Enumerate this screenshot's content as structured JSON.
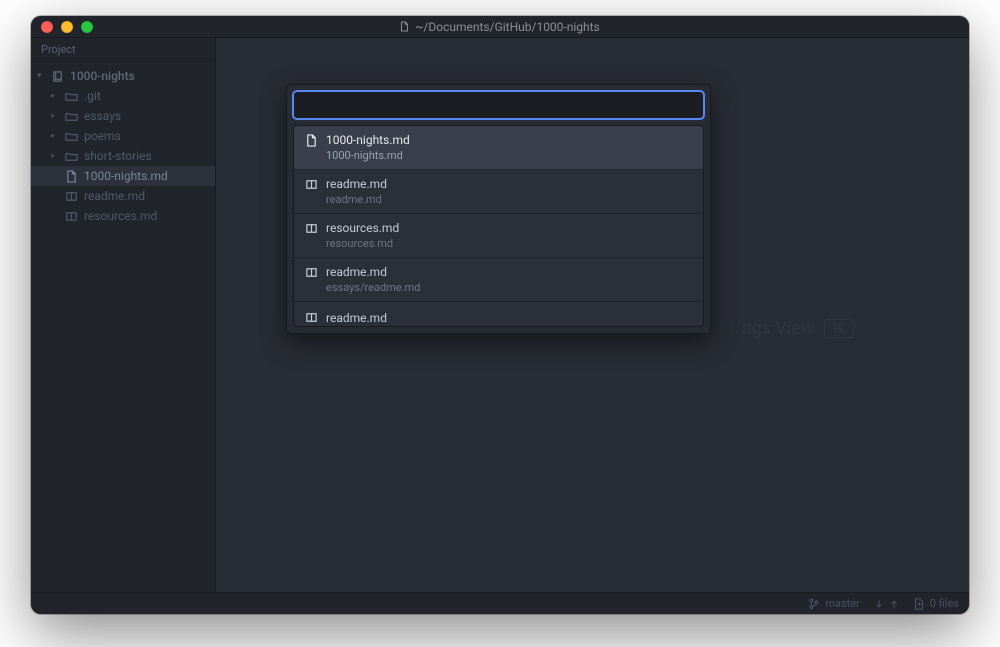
{
  "window": {
    "title_path": "~/Documents/GitHub/1000-nights"
  },
  "sidebar": {
    "header": "Project",
    "root": {
      "label": "1000-nights"
    },
    "items": [
      {
        "label": ".git",
        "kind": "folder",
        "indent": 1
      },
      {
        "label": "essays",
        "kind": "folder",
        "indent": 1
      },
      {
        "label": "poems",
        "kind": "folder",
        "indent": 1
      },
      {
        "label": "short-stories",
        "kind": "folder",
        "indent": 1
      },
      {
        "label": "1000-nights.md",
        "kind": "file-doc",
        "indent": 1,
        "selected": true
      },
      {
        "label": "readme.md",
        "kind": "file-book",
        "indent": 1
      },
      {
        "label": "resources.md",
        "kind": "file-book",
        "indent": 1
      }
    ]
  },
  "ghost": {
    "text": "ngs View",
    "shortcut": "⌘,"
  },
  "fuzzy": {
    "search_value": "",
    "placeholder": "",
    "results": [
      {
        "name": "1000-nights.md",
        "path": "1000-nights.md",
        "icon": "file-doc",
        "selected": true
      },
      {
        "name": "readme.md",
        "path": "readme.md",
        "icon": "file-book",
        "selected": false
      },
      {
        "name": "resources.md",
        "path": "resources.md",
        "icon": "file-book",
        "selected": false
      },
      {
        "name": "readme.md",
        "path": "essays/readme.md",
        "icon": "file-book",
        "selected": false
      },
      {
        "name": "readme.md",
        "path": "",
        "icon": "file-book",
        "selected": false,
        "partial": true
      }
    ]
  },
  "statusbar": {
    "branch": "master",
    "git_arrows": "",
    "files": "0 files"
  }
}
